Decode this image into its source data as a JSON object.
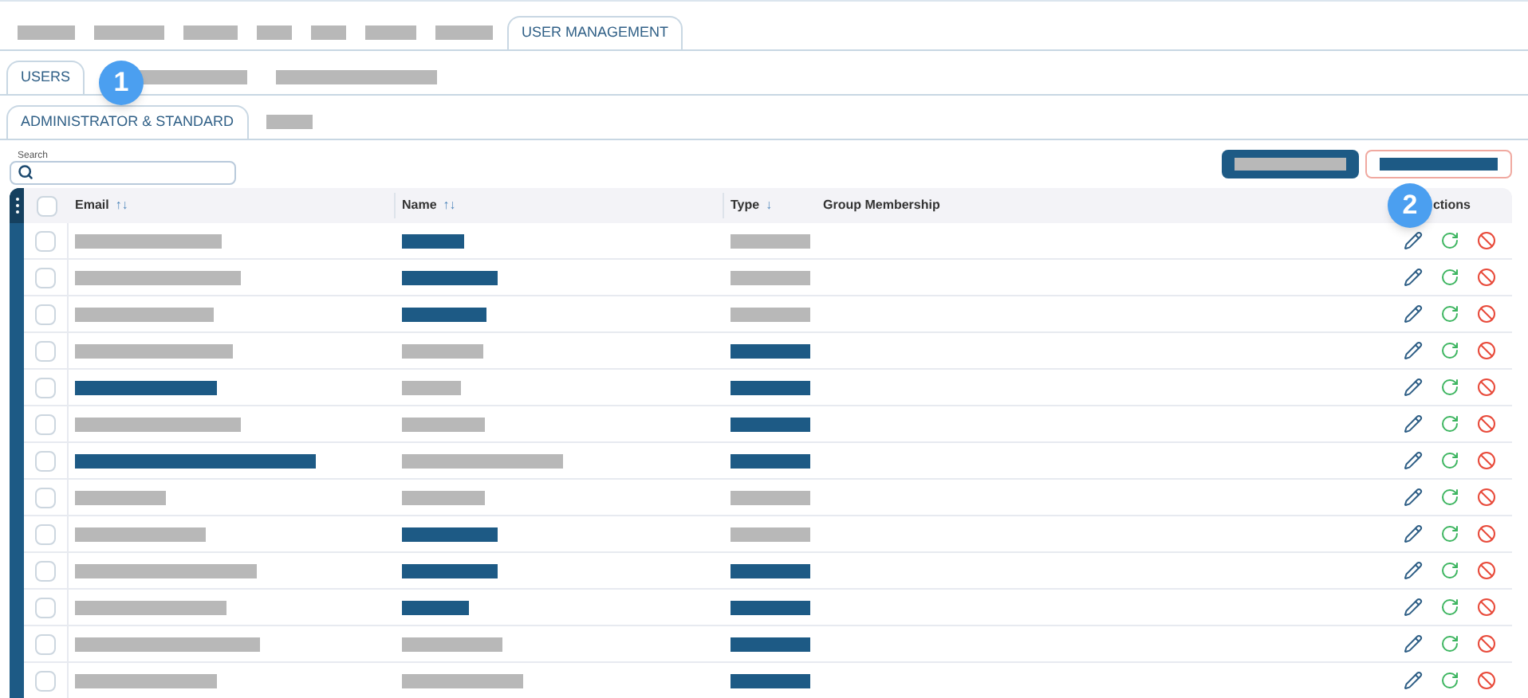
{
  "top_tabs": [
    {
      "kind": "redacted",
      "selected": false
    },
    {
      "kind": "redacted",
      "selected": false
    },
    {
      "kind": "redacted",
      "selected": false
    },
    {
      "kind": "redacted",
      "selected": false
    },
    {
      "kind": "redacted",
      "selected": false
    },
    {
      "kind": "redacted",
      "selected": false
    },
    {
      "kind": "redacted",
      "selected": false
    },
    {
      "kind": "text",
      "label": "USER MANAGEMENT",
      "selected": true
    }
  ],
  "sub_tabs": [
    {
      "kind": "text",
      "label": "USERS",
      "selected": true
    },
    {
      "kind": "redacted",
      "selected": false
    },
    {
      "kind": "redacted",
      "selected": false
    }
  ],
  "group_tabs": [
    {
      "kind": "text",
      "label": "ADMINISTRATOR & STANDARD",
      "selected": true
    },
    {
      "kind": "redacted",
      "selected": false
    }
  ],
  "callouts": [
    "1",
    "2"
  ],
  "search": {
    "label": "Search"
  },
  "buttons": [
    {
      "kind": "filled",
      "color": "#b8b8b8"
    },
    {
      "kind": "outline",
      "color": "#1d5a85"
    }
  ],
  "table": {
    "all_checked": false,
    "columns": [
      {
        "label": "Email",
        "sort": "↑↓"
      },
      {
        "label": "Name",
        "sort": "↑↓"
      },
      {
        "label": "Type",
        "sort": "↓"
      },
      {
        "label": "Group Membership"
      },
      {
        "label": "ctions"
      }
    ],
    "rows": [
      {
        "checked": false,
        "cells": [
          {
            "color": "#b8b8b8"
          },
          {
            "color": "#1d5a85"
          },
          {
            "color": "#b8b8b8"
          }
        ]
      },
      {
        "checked": false,
        "cells": [
          {
            "color": "#b8b8b8"
          },
          {
            "color": "#1d5a85"
          },
          {
            "color": "#b8b8b8"
          }
        ]
      },
      {
        "checked": false,
        "cells": [
          {
            "color": "#b8b8b8"
          },
          {
            "color": "#1d5a85"
          },
          {
            "color": "#b8b8b8"
          }
        ]
      },
      {
        "checked": false,
        "cells": [
          {
            "color": "#b8b8b8"
          },
          {
            "color": "#b8b8b8"
          },
          {
            "color": "#1d5a85"
          }
        ]
      },
      {
        "checked": false,
        "cells": [
          {
            "color": "#1d5a85"
          },
          {
            "color": "#b8b8b8"
          },
          {
            "color": "#1d5a85"
          }
        ]
      },
      {
        "checked": false,
        "cells": [
          {
            "color": "#b8b8b8"
          },
          {
            "color": "#b8b8b8"
          },
          {
            "color": "#1d5a85"
          }
        ]
      },
      {
        "checked": false,
        "cells": [
          {
            "color": "#1d5a85"
          },
          {
            "color": "#b8b8b8"
          },
          {
            "color": "#1d5a85"
          }
        ]
      },
      {
        "checked": false,
        "cells": [
          {
            "color": "#b8b8b8"
          },
          {
            "color": "#b8b8b8"
          },
          {
            "color": "#b8b8b8"
          }
        ]
      },
      {
        "checked": false,
        "cells": [
          {
            "color": "#b8b8b8"
          },
          {
            "color": "#1d5a85"
          },
          {
            "color": "#b8b8b8"
          }
        ]
      },
      {
        "checked": false,
        "cells": [
          {
            "color": "#b8b8b8"
          },
          {
            "color": "#1d5a85"
          },
          {
            "color": "#1d5a85"
          }
        ]
      },
      {
        "checked": false,
        "cells": [
          {
            "color": "#b8b8b8"
          },
          {
            "color": "#1d5a85"
          },
          {
            "color": "#1d5a85"
          }
        ]
      },
      {
        "checked": false,
        "cells": [
          {
            "color": "#b8b8b8"
          },
          {
            "color": "#b8b8b8"
          },
          {
            "color": "#1d5a85"
          }
        ]
      },
      {
        "checked": false,
        "cells": [
          {
            "color": "#b8b8b8"
          },
          {
            "color": "#b8b8b8"
          },
          {
            "color": "#1d5a85"
          }
        ]
      }
    ]
  }
}
